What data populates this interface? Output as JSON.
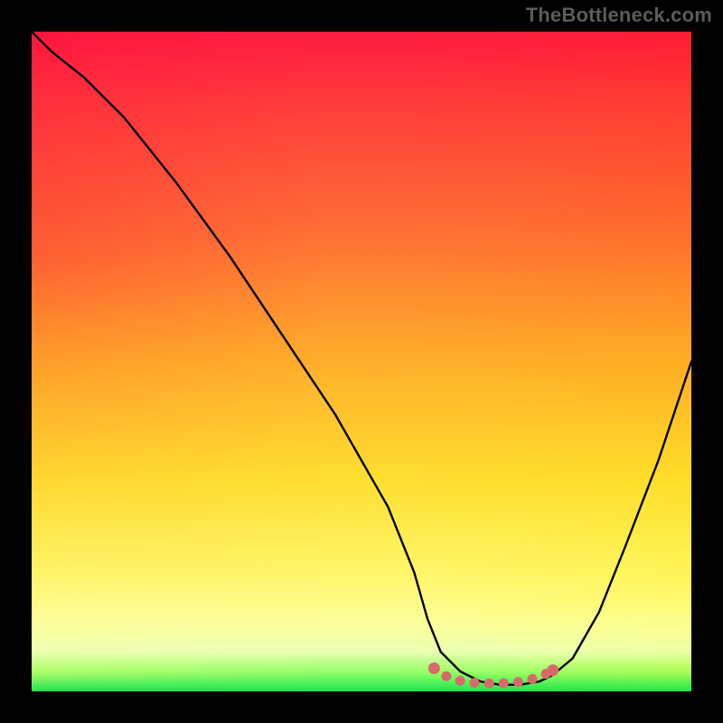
{
  "watermark": "TheBottleneck.com",
  "chart_data": {
    "type": "line",
    "title": "",
    "xlabel": "",
    "ylabel": "",
    "xlim": [
      0,
      100
    ],
    "ylim": [
      0,
      100
    ],
    "legend": false,
    "grid": false,
    "background": "rainbow-gradient",
    "series": [
      {
        "name": "bottleneck-curve",
        "color": "#000000",
        "x": [
          0,
          3,
          8,
          14,
          22,
          30,
          38,
          46,
          54,
          58,
          60,
          62,
          65,
          68,
          71,
          74,
          77,
          79,
          82,
          86,
          90,
          95,
          100
        ],
        "values": [
          100,
          97,
          93,
          87,
          77,
          66,
          54,
          42,
          28,
          18,
          11,
          6,
          3,
          1.5,
          1,
          1,
          1.5,
          2.5,
          5,
          12,
          22,
          35,
          50
        ]
      },
      {
        "name": "bottom-marker",
        "color": "#d86a6a",
        "style": "thick-dotted",
        "x": [
          61,
          63,
          65,
          67,
          69,
          71,
          73,
          75,
          77,
          79
        ],
        "values": [
          3.5,
          2.2,
          1.6,
          1.3,
          1.2,
          1.2,
          1.3,
          1.6,
          2.2,
          3.2
        ]
      }
    ],
    "annotations": []
  },
  "colors": {
    "frame": "#000000",
    "curve": "#000000",
    "marker": "#d86a6a"
  }
}
